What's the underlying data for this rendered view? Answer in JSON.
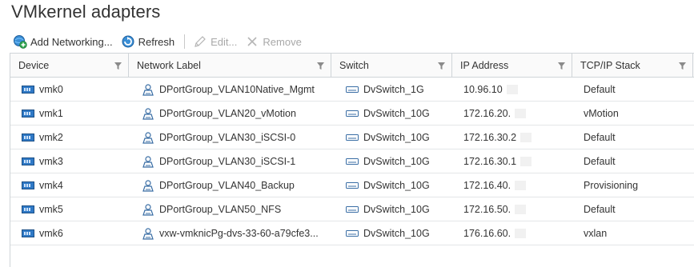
{
  "page": {
    "title": "VMkernel adapters"
  },
  "toolbar": {
    "add_label": "Add Networking...",
    "refresh_label": "Refresh",
    "edit_label": "Edit...",
    "remove_label": "Remove"
  },
  "grid": {
    "columns": [
      "Device",
      "Network Label",
      "Switch",
      "IP Address",
      "TCP/IP Stack"
    ],
    "rows": [
      {
        "device": "vmk0",
        "network_label": "DPortGroup_VLAN10Native_Mgmt",
        "switch": "DvSwitch_1G",
        "ip": "10.96.10",
        "stack": "Default"
      },
      {
        "device": "vmk1",
        "network_label": "DPortGroup_VLAN20_vMotion",
        "switch": "DvSwitch_10G",
        "ip": "172.16.20.",
        "stack": "vMotion"
      },
      {
        "device": "vmk2",
        "network_label": "DPortGroup_VLAN30_iSCSI-0",
        "switch": "DvSwitch_10G",
        "ip": "172.16.30.2",
        "stack": "Default"
      },
      {
        "device": "vmk3",
        "network_label": "DPortGroup_VLAN30_iSCSI-1",
        "switch": "DvSwitch_10G",
        "ip": "172.16.30.1",
        "stack": "Default"
      },
      {
        "device": "vmk4",
        "network_label": "DPortGroup_VLAN40_Backup",
        "switch": "DvSwitch_10G",
        "ip": "172.16.40.",
        "stack": "Provisioning"
      },
      {
        "device": "vmk5",
        "network_label": "DPortGroup_VLAN50_NFS",
        "switch": "DvSwitch_10G",
        "ip": "172.16.50.",
        "stack": "Default"
      },
      {
        "device": "vmk6",
        "network_label": "vxw-vmknicPg-dvs-33-60-a79cfe3...",
        "switch": "DvSwitch_10G",
        "ip": "176.16.60.",
        "stack": "vxlan"
      }
    ]
  },
  "icons": {
    "add": "add-networking-icon",
    "refresh": "refresh-icon",
    "edit": "pencil-icon",
    "remove": "x-icon",
    "filter": "filter-funnel-icon",
    "nic": "vmkernel-nic-icon",
    "portgroup": "portgroup-icon",
    "switch": "switch-icon"
  },
  "colors": {
    "nic_blue": "#2f79c6",
    "header_bg": "#fafafa",
    "border": "#cfd4d8"
  }
}
